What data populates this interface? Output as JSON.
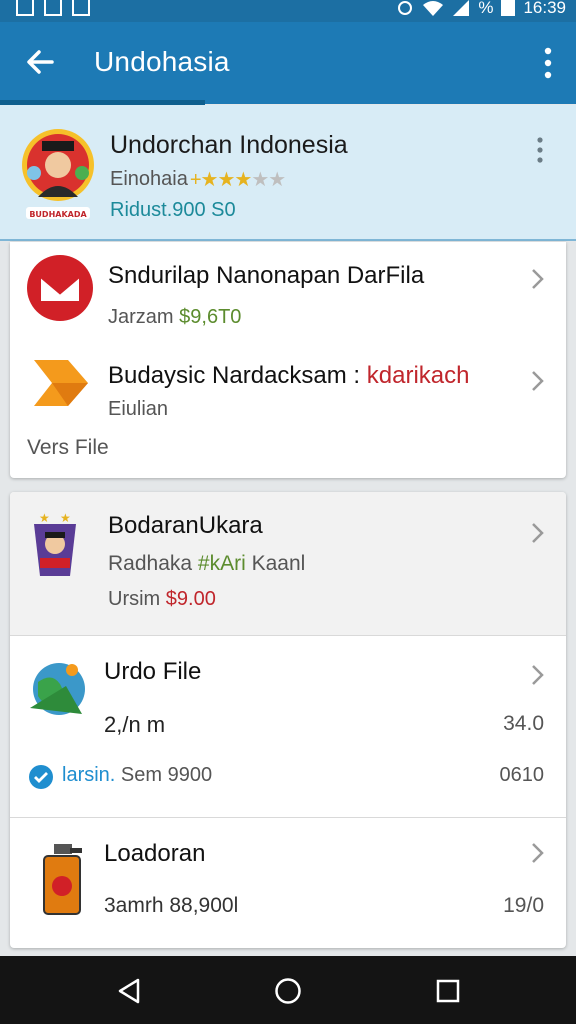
{
  "status_bar": {
    "time": "16:39",
    "battery_icon": "battery-icon",
    "signal_percent": "%"
  },
  "app_bar": {
    "title": "Undohasia",
    "back_icon": "arrow-back-icon",
    "menu_icon": "more-vert-icon"
  },
  "header": {
    "name": "Undorchan Indonesia",
    "subtitle": "Einohaia",
    "rating": 3,
    "rating_max": 5,
    "price": "Ridust.900  S0"
  },
  "card1": {
    "items": [
      {
        "name": "Sndurilap Nanonapan DarFila",
        "sub_label": "Jarzam",
        "sub_value": "$9,6T0"
      },
      {
        "name": "Budaysic Nardacksam :",
        "name_accent": "kdarikach",
        "sub_label": "Eiulian"
      }
    ],
    "footer": "Vers File"
  },
  "card2": {
    "items": [
      {
        "name": "BodaranUkara",
        "line1_label": "Radhaka",
        "line1_accent": "#kAri",
        "line1_rest": "Kaanl",
        "line2_label": "Ursim",
        "line2_value": "$9.00"
      },
      {
        "name": "Urdo File",
        "line1": "2,/n m",
        "line1_right": "34.0",
        "line2_label": "larsin.",
        "line2_rest": "Sem 9900",
        "line2_right": "0610"
      },
      {
        "name": "Loadoran",
        "line1": "3amrh 88,900l",
        "line1_right": "19/0"
      }
    ]
  },
  "colors": {
    "appbar": "#1d7ab5",
    "header_bg": "#d8ecf6",
    "accent_green": "#5c8c2e",
    "accent_red": "#c0262c"
  }
}
